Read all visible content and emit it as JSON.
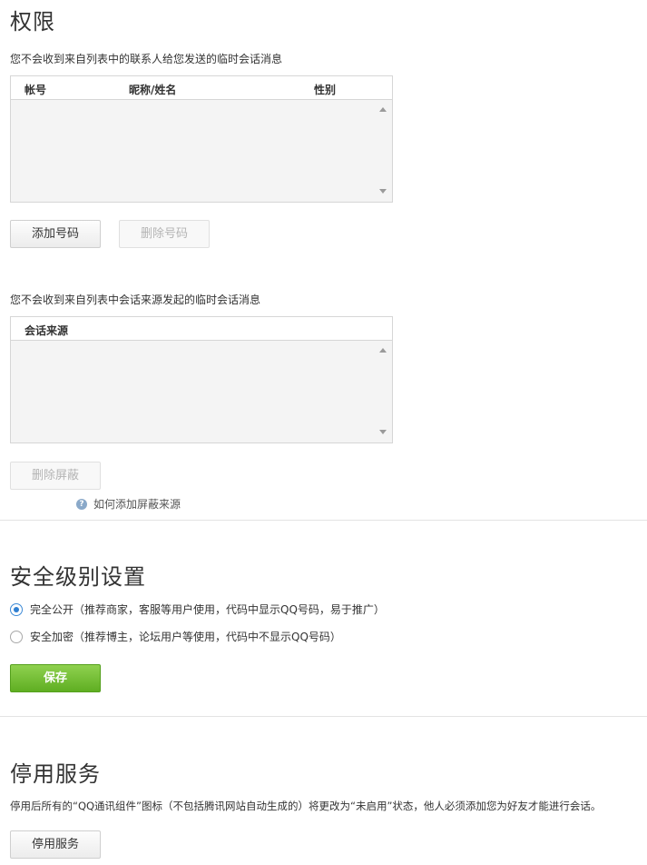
{
  "permissions": {
    "title": "权限",
    "contacts_desc": "您不会收到来自列表中的联系人给您发送的临时会话消息",
    "contacts_table": {
      "columns": [
        "帐号",
        "昵称/姓名",
        "性别"
      ],
      "rows": []
    },
    "add_button": "添加号码",
    "delete_button": "删除号码",
    "sources_desc": "您不会收到来自列表中会话来源发起的临时会话消息",
    "sources_table": {
      "columns": [
        "会话来源"
      ],
      "rows": []
    },
    "delete_block_button": "删除屏蔽",
    "help_link": "如何添加屏蔽来源"
  },
  "security": {
    "title": "安全级别设置",
    "options": [
      {
        "label": "完全公开（推荐商家，客服等用户使用，代码中显示QQ号码，易于推广）",
        "checked": true
      },
      {
        "label": "安全加密（推荐博主，论坛用户等使用，代码中不显示QQ号码）",
        "checked": false
      }
    ],
    "save_button": "保存"
  },
  "disable": {
    "title": "停用服务",
    "desc": "停用后所有的“QQ通讯组件”图标（不包括腾讯网站自动生成的）将更改为“未启用”状态，他人必须添加您为好友才能进行会话。",
    "button": "停用服务"
  },
  "colors": {
    "accent_green": "#6dbb30",
    "radio_blue": "#2f7fd1"
  }
}
